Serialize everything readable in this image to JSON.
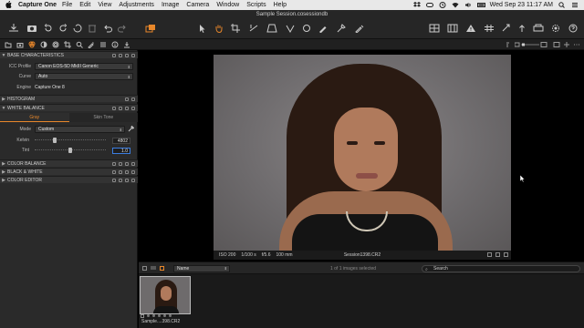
{
  "menubar": {
    "app_name": "Capture One",
    "items": [
      "File",
      "Edit",
      "View",
      "Adjustments",
      "Image",
      "Camera",
      "Window",
      "Scripts",
      "Help"
    ],
    "clock": "Wed Sep 23  11:17 AM"
  },
  "window": {
    "title": "Sample Session.cosessiondb"
  },
  "left_panel": {
    "base": {
      "header": "BASE CHARACTERISTICS",
      "icc_label": "ICC Profile",
      "icc_value": "Canon EOS-5D MkIII Generic",
      "curve_label": "Curve",
      "curve_value": "Auto",
      "engine_label": "Engine",
      "engine_value": "Capture One 8"
    },
    "histogram_header": "HISTOGRAM",
    "wb": {
      "header": "WHITE BALANCE",
      "tab_gray": "Gray",
      "tab_skin": "Skin Tone",
      "mode_label": "Mode",
      "mode_value": "Custom",
      "kelvin_label": "Kelvin",
      "kelvin_value": "4802",
      "kelvin_level": 0.27,
      "tint_label": "Tint",
      "tint_value": "1.0",
      "tint_level": 0.5
    },
    "color_balance_header": "COLOR BALANCE",
    "bw_header": "BLACK & WHITE",
    "color_editor_header": "COLOR EDITOR"
  },
  "viewer": {
    "iso": "ISO 200",
    "shutter": "1/100 s",
    "aperture": "f/5.6",
    "focal": "100 mm",
    "filename": "Session1398.CR2"
  },
  "browser": {
    "sort_value": "Name",
    "selected_text": "1 of 1 images selected",
    "search_placeholder": "Search",
    "thumb_label": "Sample....398.CR2"
  },
  "colors": {
    "accent_orange": "#e8872a",
    "focus_blue": "#3b7de0"
  }
}
